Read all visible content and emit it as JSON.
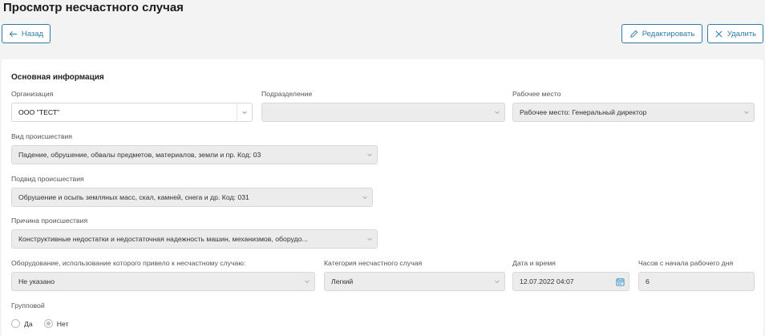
{
  "page": {
    "title": "Просмотр несчастного случая"
  },
  "toolbar": {
    "back_label": "Назад",
    "edit_label": "Редактировать",
    "delete_label": "Удалить"
  },
  "section": {
    "title": "Основная информация"
  },
  "fields": {
    "organization": {
      "label": "Организация",
      "value": "ООО \"ТЕСТ\""
    },
    "department": {
      "label": "Подразделение",
      "value": ""
    },
    "workplace": {
      "label": "Рабочее место",
      "value": "Рабочее место: Генеральный директор"
    },
    "incident_type": {
      "label": "Вид происшествия",
      "value": "Падение, обрушение, обвалы предметов, материалов, земли и пр. Код: 03"
    },
    "incident_subtype": {
      "label": "Подвид происшествия",
      "value": "Обрушение и осыпь земляных масс, скал, камней, снега и др. Код: 031"
    },
    "incident_cause": {
      "label": "Причина происшествия",
      "value": "Конструктивные недостатки и недостаточная надежность машин, механизмов, оборудо..."
    },
    "equipment": {
      "label": "Оборудование, использование которого привело к несчастному случаю:",
      "value": "Не указано"
    },
    "category": {
      "label": "Категория несчастного случая",
      "value": "Легкий"
    },
    "datetime": {
      "label": "Дата и время",
      "value": "12.07.2022 04:07"
    },
    "hours": {
      "label": "Часов с начала рабочего дня",
      "value": "6"
    }
  },
  "group": {
    "label": "Групповой",
    "options": [
      "Да",
      "Нет"
    ],
    "selected": "Нет"
  },
  "colors": {
    "accent": "#2d7ea6",
    "calendar_icon": "#2d8fc4"
  }
}
